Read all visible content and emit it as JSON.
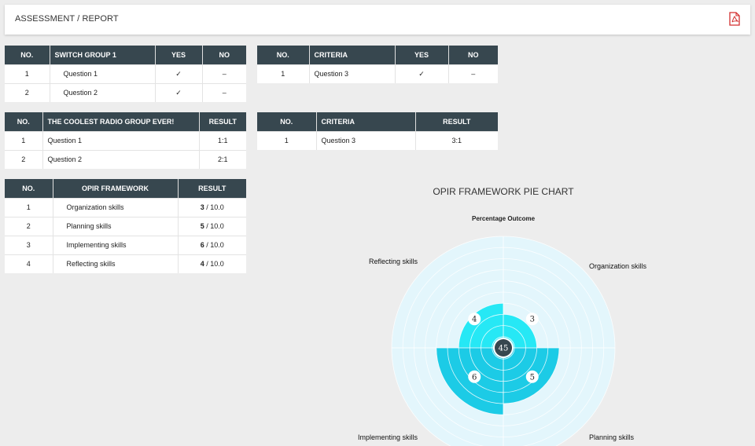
{
  "header": {
    "title": "ASSESSMENT / REPORT",
    "pdf_icon": "pdf-icon"
  },
  "switch_table": {
    "headers": [
      "NO.",
      "SWITCH GROUP 1",
      "YES",
      "NO"
    ],
    "rows": [
      {
        "no": "1",
        "question": "Question 1",
        "yes": "✓",
        "no_val": "–"
      },
      {
        "no": "2",
        "question": "Question 2",
        "yes": "✓",
        "no_val": "–"
      }
    ]
  },
  "criteria_yes_table": {
    "headers": [
      "NO.",
      "CRITERIA",
      "YES",
      "NO"
    ],
    "rows": [
      {
        "no": "1",
        "criteria": "Question 3",
        "yes": "✓",
        "no_val": "–"
      }
    ]
  },
  "radio_table": {
    "headers": [
      "NO.",
      "THE COOLEST RADIO GROUP EVER!",
      "RESULT"
    ],
    "rows": [
      {
        "no": "1",
        "question": "Question 1",
        "result": "1:1"
      },
      {
        "no": "2",
        "question": "Question 2",
        "result": "2:1"
      }
    ]
  },
  "criteria_result_table": {
    "headers": [
      "NO.",
      "CRITERIA",
      "RESULT"
    ],
    "rows": [
      {
        "no": "1",
        "criteria": "Question 3",
        "result": "3:1"
      }
    ]
  },
  "opir_table": {
    "headers": [
      "NO.",
      "OPIR FRAMEWORK",
      "RESULT"
    ],
    "rows": [
      {
        "no": "1",
        "skill": "Organization skills",
        "score": "3",
        "max": " / 10.0"
      },
      {
        "no": "2",
        "skill": "Planning skills",
        "score": "5",
        "max": " / 10.0"
      },
      {
        "no": "3",
        "skill": "Implementing skills",
        "score": "6",
        "max": " / 10.0"
      },
      {
        "no": "4",
        "skill": "Reflecting skills",
        "score": "4",
        "max": " / 10.0"
      }
    ]
  },
  "chart_data": {
    "type": "polar-area",
    "title": "OPIR FRAMEWORK PIE CHART",
    "subtitle": "Percentage Outcome",
    "categories": [
      "Organization skills",
      "Planning skills",
      "Implementing skills",
      "Reflecting skills"
    ],
    "values": [
      3,
      5,
      6,
      4
    ],
    "max": 10,
    "center_total": "45",
    "colors": {
      "fill_light": "#26e8f5",
      "fill_dark": "#1ccbe6",
      "background": "#e3f6fc",
      "center": "#37474f"
    }
  }
}
